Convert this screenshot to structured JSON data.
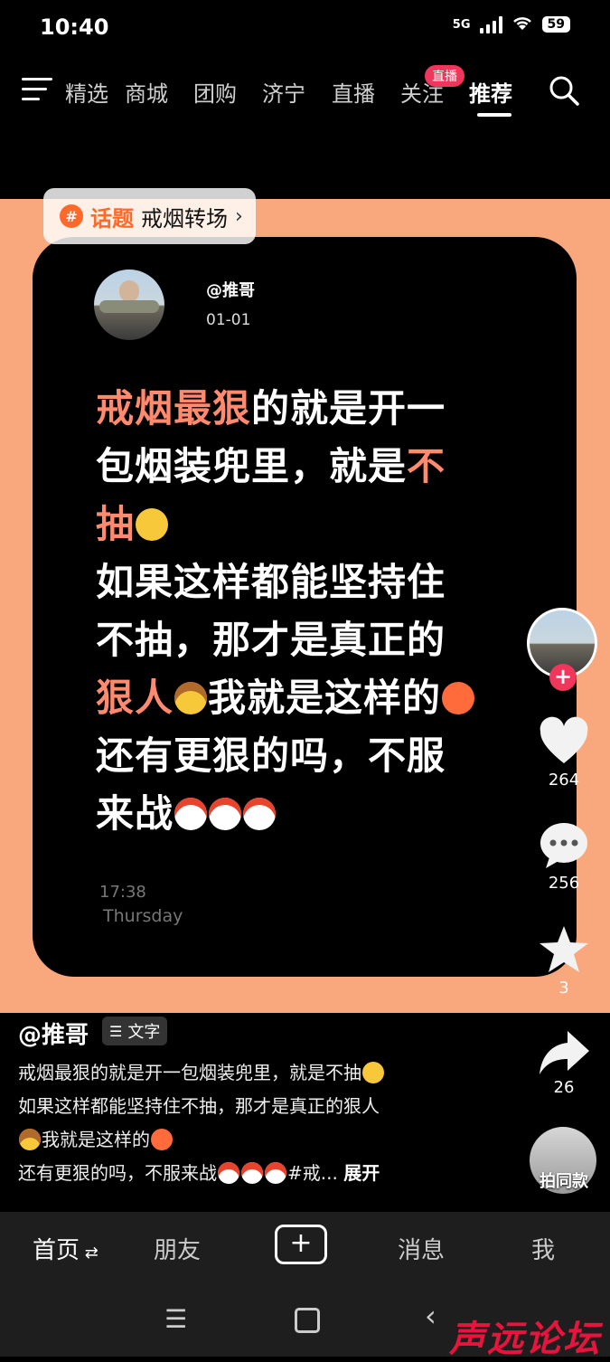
{
  "status_bar": {
    "time": "10:40",
    "network": "5G",
    "battery": "59"
  },
  "top_nav": {
    "tabs": [
      "精选",
      "商城",
      "团购",
      "济宁",
      "直播",
      "关注",
      "推荐"
    ],
    "active_tab": "推荐",
    "live_badge": "直播"
  },
  "topic": {
    "icon": "#",
    "label": "话题",
    "name": "戒烟转场"
  },
  "card": {
    "handle": "@推哥",
    "date": "01-01",
    "text": {
      "l1_hl": "戒烟最狠",
      "l1": "的就是开一",
      "l2": "包烟装兜里，就是",
      "l2_hl": "不",
      "l3_hl": "抽",
      "l4": "如果这样都能坚持住",
      "l5": "不抽，那才是真正的",
      "l6_hl": "狠人",
      "l6": "我就是这样的",
      "l7": "还有更狠的吗，不服",
      "l8": "来战"
    },
    "clock": "17:38",
    "day": "Thursday"
  },
  "rail": {
    "likes": "264",
    "comments": "256",
    "favorites": "3",
    "shares": "26",
    "same_style": "拍同款"
  },
  "info": {
    "author": "@推哥",
    "text_chip": "文字",
    "desc_l1": "戒烟最狠的就是开一包烟装兜里，就是不抽",
    "desc_l2": "如果这样都能坚持住不抽，那才是真正的狠人",
    "desc_l3": "我就是这样的",
    "desc_l4a": "还有更狠的吗，不服来战",
    "desc_l4b": "#戒...",
    "desc_more": "展开"
  },
  "bottom_nav": {
    "home": "首页",
    "friends": "朋友",
    "plus": "+",
    "messages": "消息",
    "me": "我"
  },
  "watermark": "声远论坛",
  "colors": {
    "accent": "#f0365a",
    "video_bg": "#f9a77d",
    "highlight": "#ff8a6e",
    "topic": "#ff6a2b"
  }
}
